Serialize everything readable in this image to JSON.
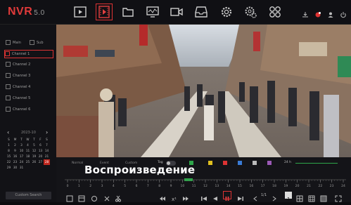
{
  "app": {
    "logo": "NVR",
    "version": "5.0"
  },
  "toolbar": {
    "items": [
      {
        "name": "live-view-icon",
        "active": false
      },
      {
        "name": "playback-icon",
        "active": true
      },
      {
        "name": "file-folder-icon",
        "active": false
      },
      {
        "name": "monitor-icon",
        "active": false
      },
      {
        "name": "video-camera-icon",
        "active": false
      },
      {
        "name": "backup-tray-icon",
        "active": false
      },
      {
        "name": "gear-icon",
        "active": false
      },
      {
        "name": "system-settings-icon",
        "active": false
      },
      {
        "name": "grid-layout-icon",
        "active": false
      }
    ],
    "right_icons": [
      "download-icon",
      "alarm-icon",
      "user-icon",
      "power-icon"
    ]
  },
  "sidebar": {
    "main_label": "Main",
    "sub_label": "Sub",
    "channels": [
      "Channel 1",
      "Channel 2",
      "Channel 3",
      "Channel 4",
      "Channel 5",
      "Channel 6"
    ],
    "selected_channel_index": 0,
    "calendar": {
      "month_label": "2023-10",
      "weekdays": [
        "S",
        "M",
        "T",
        "W",
        "T",
        "F",
        "S"
      ],
      "days": [
        "1",
        "2",
        "3",
        "4",
        "5",
        "6",
        "7",
        "8",
        "9",
        "10",
        "11",
        "12",
        "13",
        "14",
        "15",
        "16",
        "17",
        "18",
        "19",
        "20",
        "21",
        "22",
        "23",
        "24",
        "25",
        "26",
        "27",
        "28",
        "29",
        "30",
        "31"
      ],
      "selected_day": "28"
    },
    "search_button": "Custom Search"
  },
  "controls": {
    "tag_label": "Tag",
    "tabs": [
      "Normal",
      "Event",
      "Custom"
    ],
    "speed_label": "24 h",
    "legend_colors": [
      "#2ea64a",
      "#e0c020",
      "#d33",
      "#3a7bd5",
      "#bbbbbb",
      "#9b59b6"
    ]
  },
  "caption": "Воспроизведение",
  "timeline": {
    "hours": [
      "0",
      "1",
      "2",
      "3",
      "4",
      "5",
      "6",
      "7",
      "8",
      "9",
      "10",
      "11",
      "12",
      "13",
      "14",
      "15",
      "16",
      "17",
      "18",
      "19",
      "20",
      "21",
      "22",
      "23",
      "24"
    ]
  },
  "playback": {
    "page_label": "1/1",
    "buttons": [
      "layout-1-icon",
      "snapshot-icon",
      "backup-icon",
      "cut-icon",
      "rewind-icon",
      "slow-icon",
      "fast-forward-icon",
      "prev-frame-icon",
      "play-reverse-icon",
      "pause-icon",
      "next-frame-icon",
      "page-label",
      "split-1-icon",
      "split-4-icon",
      "split-9-icon",
      "fullscreen-icon"
    ]
  }
}
